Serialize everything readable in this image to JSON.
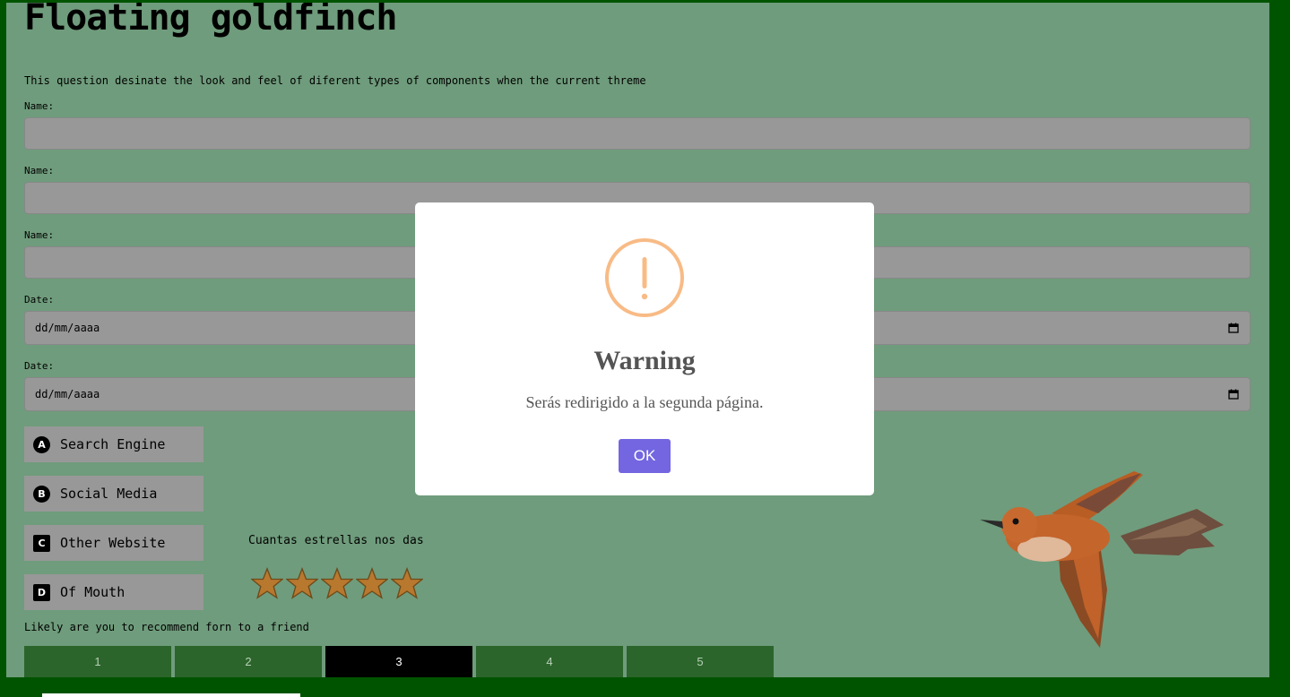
{
  "page": {
    "title": "Floating goldfinch",
    "intro": "This question desinate the look and feel of diferent types of components when the current threme"
  },
  "form": {
    "fields": [
      {
        "label": "Name:",
        "value": ""
      },
      {
        "label": "Name:",
        "value": ""
      },
      {
        "label": "Name:",
        "value": ""
      }
    ],
    "dates": [
      {
        "label": "Date:",
        "value": "dd/mm/aaaa"
      },
      {
        "label": "Date:",
        "value": "dd/mm/aaaa"
      }
    ],
    "options": [
      {
        "letter": "A",
        "label": "Search Engine"
      },
      {
        "letter": "B",
        "label": "Social Media"
      },
      {
        "letter": "C",
        "label": "Other Website"
      },
      {
        "letter": "D",
        "label": "Of Mouth"
      }
    ],
    "stars": {
      "question": "Cuantas estrellas nos das",
      "count": 5,
      "color": "#b8782e"
    },
    "recommend": {
      "question": "Likely are you to recommend forn to a friend",
      "scale": [
        "1",
        "2",
        "3",
        "4",
        "5"
      ],
      "selected": "3"
    }
  },
  "modal": {
    "icon": "warning-icon",
    "title": "Warning",
    "text": "Serás redirigido a la segunda página.",
    "ok_label": "OK",
    "icon_color": "#f8bb86",
    "button_color": "#7366e0"
  },
  "colors": {
    "frame": "#005400",
    "background": "#6f9c7c",
    "input": "#989898",
    "scale": "#2b652b"
  }
}
